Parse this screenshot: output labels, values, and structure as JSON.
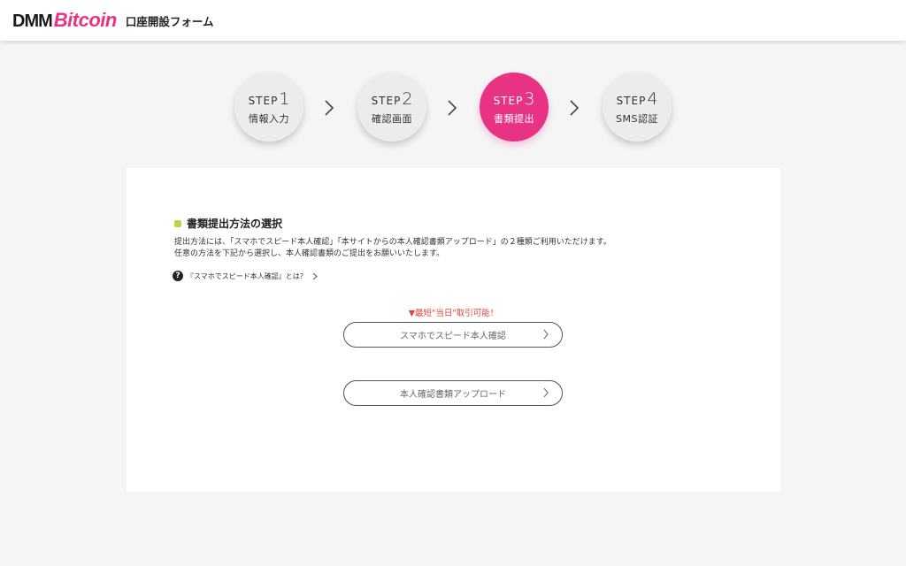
{
  "header": {
    "logo_dmm": "DMM",
    "logo_bitcoin": "Bitcoin",
    "title": "口座開設フォーム",
    "brand_color": "#e83385"
  },
  "steps": [
    {
      "word": "STEP",
      "num": "1",
      "label": "情報入力",
      "active": false
    },
    {
      "word": "STEP",
      "num": "2",
      "label": "確認画面",
      "active": false
    },
    {
      "word": "STEP",
      "num": "3",
      "label": "書類提出",
      "active": true
    },
    {
      "word": "STEP",
      "num": "4",
      "label": "SMS認証",
      "active": false
    }
  ],
  "main": {
    "section_title": "書類提出方法の選択",
    "desc_line1": "提出方法には、「スマホでスピード本人確認」「本サイトからの本人確認書類アップロード」の２種類ご利用いただけます。",
    "desc_line2": "任意の方法を下記から選択し、本人確認書類のご提出をお願いいたします。",
    "help_icon": "question-circle-icon",
    "help_link": "『スマホでスピード本人確認』とは？",
    "note": "▼最短\"当日\"取引可能！",
    "btn_speed": "スマホでスピード本人確認",
    "btn_upload": "本人確認書類アップロード",
    "accent_color": "#b6d748",
    "note_color": "#e5433a"
  }
}
